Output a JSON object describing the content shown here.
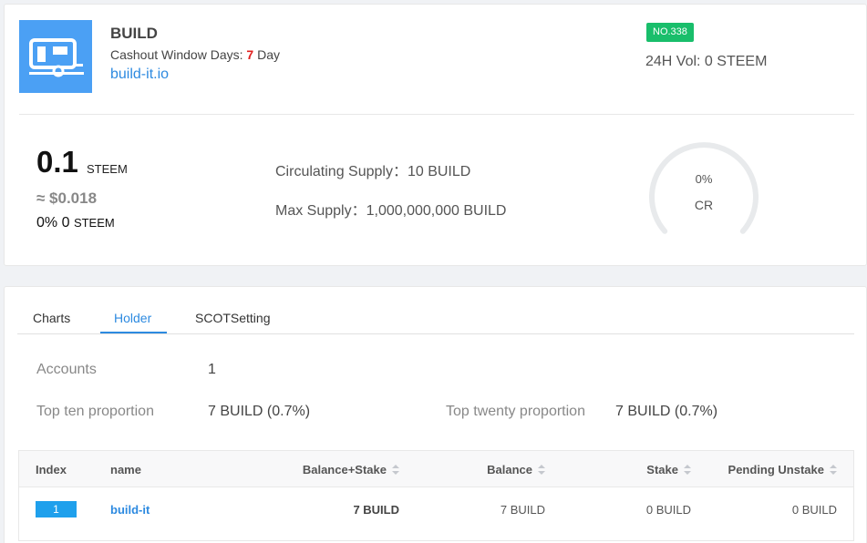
{
  "token": {
    "name": "BUILD",
    "cashout_prefix": "Cashout Window Days: ",
    "cashout_days": "7",
    "cashout_suffix": " Day",
    "site": "build-it.io",
    "rank": "NO.338",
    "volume": "24H Vol: 0 STEEM",
    "icon": "camper-trailer-icon",
    "logo_color": "#4ba0f4"
  },
  "price": {
    "value": "0.1",
    "unit": "STEEM",
    "usd": "≈ $0.018",
    "change_pct": "0%",
    "change_amount": "0",
    "change_unit": "STEEM"
  },
  "supply": {
    "circulating": "Circulating Supply：10 BUILD",
    "max": "Max Supply：1,000,000,000 BUILD"
  },
  "gauge": {
    "percent": "0%",
    "label": "CR",
    "value": 0,
    "track_color": "#e8eaec"
  },
  "tabs": [
    {
      "label": "Charts",
      "active": false
    },
    {
      "label": "Holder",
      "active": true
    },
    {
      "label": "SCOTSetting",
      "active": false
    }
  ],
  "stats": {
    "accounts_label": "Accounts",
    "accounts_value": "1",
    "top10_label": "Top ten proportion",
    "top10_value": "7 BUILD (0.7%)",
    "top20_label": "Top twenty proportion",
    "top20_value": "7 BUILD (0.7%)"
  },
  "table": {
    "columns": [
      "Index",
      "name",
      "Balance+Stake",
      "Balance",
      "Stake",
      "Pending Unstake"
    ],
    "rows": [
      {
        "index": "1",
        "name": "build-it",
        "balance_stake": "7 BUILD",
        "balance": "7 BUILD",
        "stake": "0 BUILD",
        "pending_unstake": "0 BUILD"
      }
    ]
  },
  "colors": {
    "accent": "#2d8ae0",
    "badge_green": "#19be6b",
    "highlight_red": "#e0201f",
    "index_badge": "#1fa0ec"
  }
}
